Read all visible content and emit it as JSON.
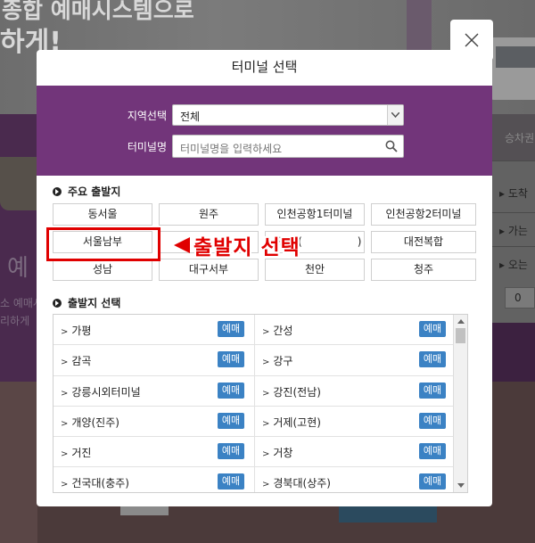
{
  "background": {
    "hero_line1": "종합 예매시스템으로",
    "hero_line2": "하게!",
    "left_big": "예",
    "left_small1": "소 예매시",
    "left_small2": "리하게",
    "right_top": "승차권 예",
    "right_items": [
      "도착",
      "가는",
      "오는"
    ],
    "right_input": "0"
  },
  "modal": {
    "title": "터미널 선택",
    "region_label": "지역선택",
    "region_value": "전체",
    "terminal_label": "터미널명",
    "terminal_placeholder": "터미널명을 입력하세요"
  },
  "major": {
    "heading": "주요 출발지",
    "buttons": [
      "동서울",
      "원주",
      "인천공항1터미널",
      "인천공항2터미널",
      "서울남부",
      "(",
      "광주(",
      ")",
      "대전복합",
      "성남",
      "대구서부",
      "천안",
      "청주"
    ]
  },
  "annotation": {
    "text": "출발지 선택"
  },
  "departure": {
    "heading": "출발지 선택",
    "book_label": "예매",
    "left": [
      "가평",
      "감곡",
      "강릉시외터미널",
      "개양(진주)",
      "거진",
      "건국대(충주)"
    ],
    "right": [
      "간성",
      "강구",
      "강진(전남)",
      "거제(고현)",
      "거창",
      "경북대(상주)"
    ]
  },
  "colors": {
    "purple": "#72357a",
    "book_button": "#3b82c4",
    "annotation_red": "#e00000"
  }
}
